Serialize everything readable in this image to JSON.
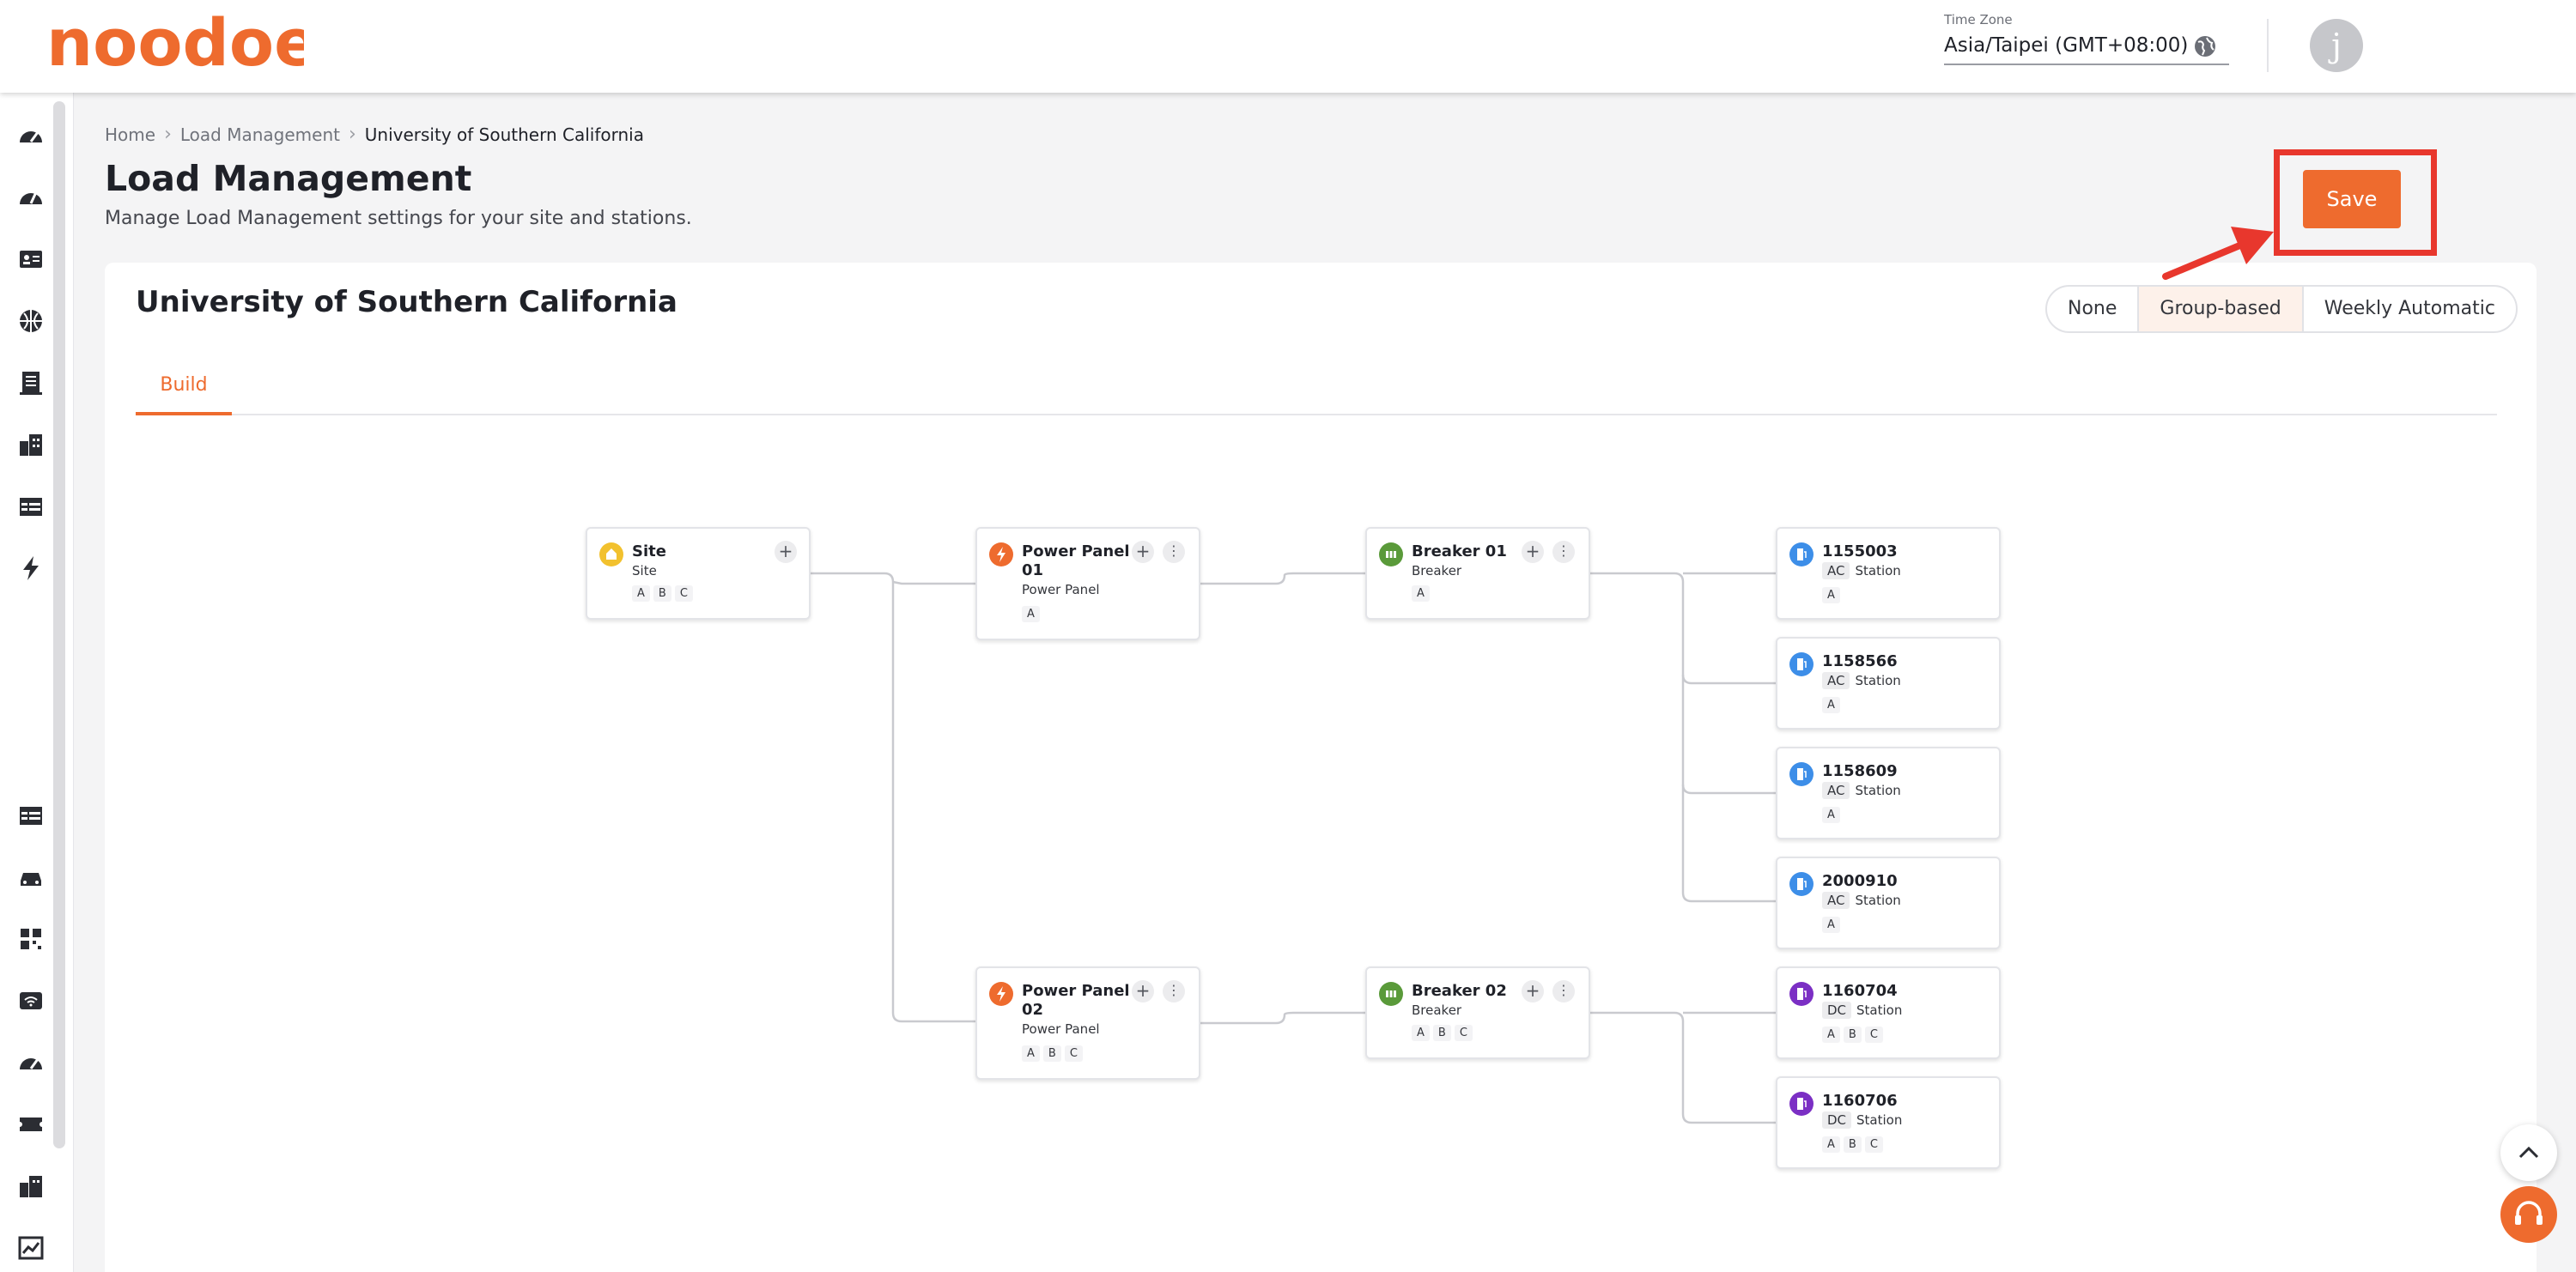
{
  "header": {
    "logo_text": "noodoe",
    "timezone_label": "Time Zone",
    "timezone_value": "Asia/Taipei (GMT+08:00)",
    "avatar_initial": "j"
  },
  "breadcrumb": {
    "home": "Home",
    "section": "Load Management",
    "current": "University of Southern California"
  },
  "page": {
    "title": "Load Management",
    "subtitle": "Manage Load Management settings for your site and stations."
  },
  "card": {
    "title": "University of Southern California",
    "modes": [
      "None",
      "Group-based",
      "Weekly Automatic"
    ],
    "active_mode": "Group-based",
    "tab_build": "Build",
    "save_label": "Save"
  },
  "tree": {
    "site": {
      "title": "Site",
      "type": "Site",
      "phases": [
        "A",
        "B",
        "C"
      ]
    },
    "pp01": {
      "title": "Power Panel 01",
      "type": "Power Panel",
      "phases": [
        "A"
      ]
    },
    "br01": {
      "title": "Breaker 01",
      "type": "Breaker",
      "phases": [
        "A"
      ]
    },
    "pp02": {
      "title": "Power Panel 02",
      "type": "Power Panel",
      "phases": [
        "A",
        "B",
        "C"
      ]
    },
    "br02": {
      "title": "Breaker 02",
      "type": "Breaker",
      "phases": [
        "A",
        "B",
        "C"
      ]
    },
    "stations": [
      {
        "id": "1155003",
        "current": "AC",
        "type": "Station",
        "phases": [
          "A"
        ]
      },
      {
        "id": "1158566",
        "current": "AC",
        "type": "Station",
        "phases": [
          "A"
        ]
      },
      {
        "id": "1158609",
        "current": "AC",
        "type": "Station",
        "phases": [
          "A"
        ]
      },
      {
        "id": "2000910",
        "current": "AC",
        "type": "Station",
        "phases": [
          "A"
        ]
      },
      {
        "id": "1160704",
        "current": "DC",
        "type": "Station",
        "phases": [
          "A",
          "B",
          "C"
        ]
      },
      {
        "id": "1160706",
        "current": "DC",
        "type": "Station",
        "phases": [
          "A",
          "B",
          "C"
        ]
      }
    ]
  },
  "colors": {
    "brand": "#ee6b2e",
    "highlight": "#e8372d",
    "site_icon": "#f2c12e",
    "panel_icon": "#ee6b2e",
    "breaker_icon": "#5a9a3a",
    "ac_icon": "#3d8ee8",
    "dc_icon": "#7b2fc4"
  }
}
